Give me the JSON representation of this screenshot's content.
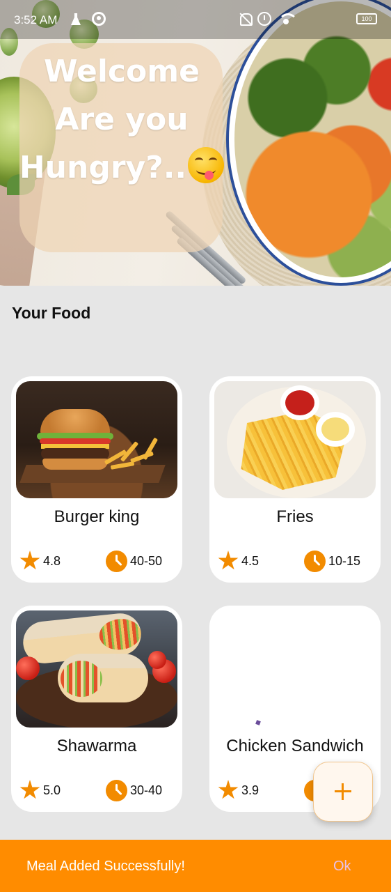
{
  "status_bar": {
    "time": "3:52 AM",
    "battery": "100"
  },
  "hero": {
    "line1": "Welcome",
    "line2": "Are you",
    "line3": "Hungry?.."
  },
  "section": {
    "title": "Your Food"
  },
  "foods": [
    {
      "name": "Burger king",
      "rating": "4.8",
      "time": "40-50"
    },
    {
      "name": "Fries",
      "rating": "4.5",
      "time": "10-15"
    },
    {
      "name": "Shawarma",
      "rating": "5.0",
      "time": "30-40"
    },
    {
      "name": "Chicken Sandwich",
      "rating": "3.9",
      "time": ""
    }
  ],
  "snackbar": {
    "message": "Meal Added Successfully!",
    "action": "Ok"
  },
  "colors": {
    "accent": "#f28b00",
    "snackbar_bg": "#ff8c00",
    "page_bg": "#e6e6e6"
  },
  "icons": {
    "rating": "star-icon",
    "time": "clock-icon",
    "fab": "plus-icon"
  }
}
